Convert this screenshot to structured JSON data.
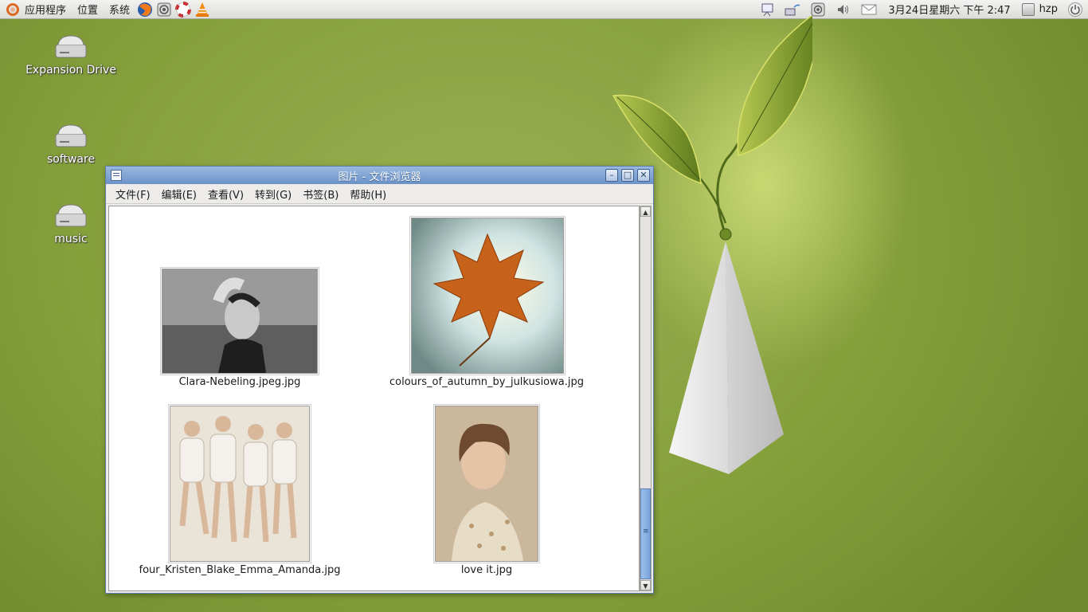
{
  "panel": {
    "menus": [
      "应用程序",
      "位置",
      "系统"
    ],
    "clock": "3月24日星期六 下午  2:47",
    "user": "hzp"
  },
  "desktop": {
    "icons": [
      {
        "label": "Expansion Drive"
      },
      {
        "label": "software"
      },
      {
        "label": "music"
      }
    ]
  },
  "window": {
    "title": "图片 - 文件浏览器",
    "menus": [
      "文件(F)",
      "编辑(E)",
      "查看(V)",
      "转到(G)",
      "书签(B)",
      "帮助(H)"
    ],
    "files": [
      {
        "name": "Clara-Nebeling.jpeg.jpg"
      },
      {
        "name": "colours_of_autumn_by_julkusiowa.jpg"
      },
      {
        "name": "four_Kristen_Blake_Emma_Amanda.jpg"
      },
      {
        "name": "love it.jpg"
      }
    ]
  },
  "colors": {
    "desktop_green": "#86a03c",
    "titlebar_blue": "#6c93c9"
  }
}
